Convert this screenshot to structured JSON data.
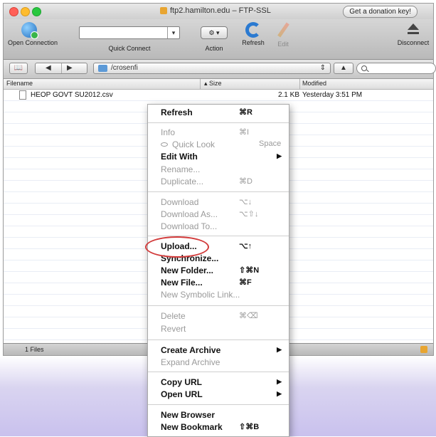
{
  "window": {
    "title": "ftp2.hamilton.edu – FTP-SSL",
    "donation_button": "Get a donation key!"
  },
  "toolbar": {
    "open_connection": "Open Connection",
    "quick_connect": "Quick Connect",
    "action": "Action",
    "refresh": "Refresh",
    "edit": "Edit",
    "disconnect": "Disconnect"
  },
  "pathbar": {
    "path": "/crosenfi",
    "search_placeholder": ""
  },
  "columns": {
    "filename": "Filename",
    "size": "▴ Size",
    "modified": "Modified"
  },
  "files": [
    {
      "name": "HEOP GOVT SU2012.csv",
      "size": "2.1 KB",
      "modified": "Yesterday 3:51 PM"
    }
  ],
  "status": {
    "count": "1 Files"
  },
  "context_menu": {
    "refresh": {
      "label": "Refresh",
      "shortcut": "⌘R"
    },
    "info": {
      "label": "Info",
      "shortcut": "⌘I"
    },
    "quick_look": {
      "label": "Quick Look",
      "shortcut": "Space"
    },
    "edit_with": {
      "label": "Edit With",
      "arrow": "▶"
    },
    "rename": {
      "label": "Rename..."
    },
    "duplicate": {
      "label": "Duplicate...",
      "shortcut": "⌘D"
    },
    "download": {
      "label": "Download",
      "shortcut": "⌥↓"
    },
    "download_as": {
      "label": "Download As...",
      "shortcut": "⌥⇧↓"
    },
    "download_to": {
      "label": "Download To..."
    },
    "upload": {
      "label": "Upload...",
      "shortcut": "⌥↑"
    },
    "synchronize": {
      "label": "Synchronize..."
    },
    "new_folder": {
      "label": "New Folder...",
      "shortcut": "⇧⌘N"
    },
    "new_file": {
      "label": "New File...",
      "shortcut": "⌘F"
    },
    "new_symbolic_link": {
      "label": "New Symbolic Link..."
    },
    "delete": {
      "label": "Delete",
      "shortcut": "⌘⌫"
    },
    "revert": {
      "label": "Revert"
    },
    "create_archive": {
      "label": "Create Archive",
      "arrow": "▶"
    },
    "expand_archive": {
      "label": "Expand Archive"
    },
    "copy_url": {
      "label": "Copy URL",
      "arrow": "▶"
    },
    "open_url": {
      "label": "Open URL",
      "arrow": "▶"
    },
    "new_browser": {
      "label": "New Browser"
    },
    "new_bookmark": {
      "label": "New Bookmark",
      "shortcut": "⇧⌘B"
    }
  },
  "colors": {
    "highlight_circle": "#d23b3b",
    "accent_blue": "#2b7ad1"
  }
}
